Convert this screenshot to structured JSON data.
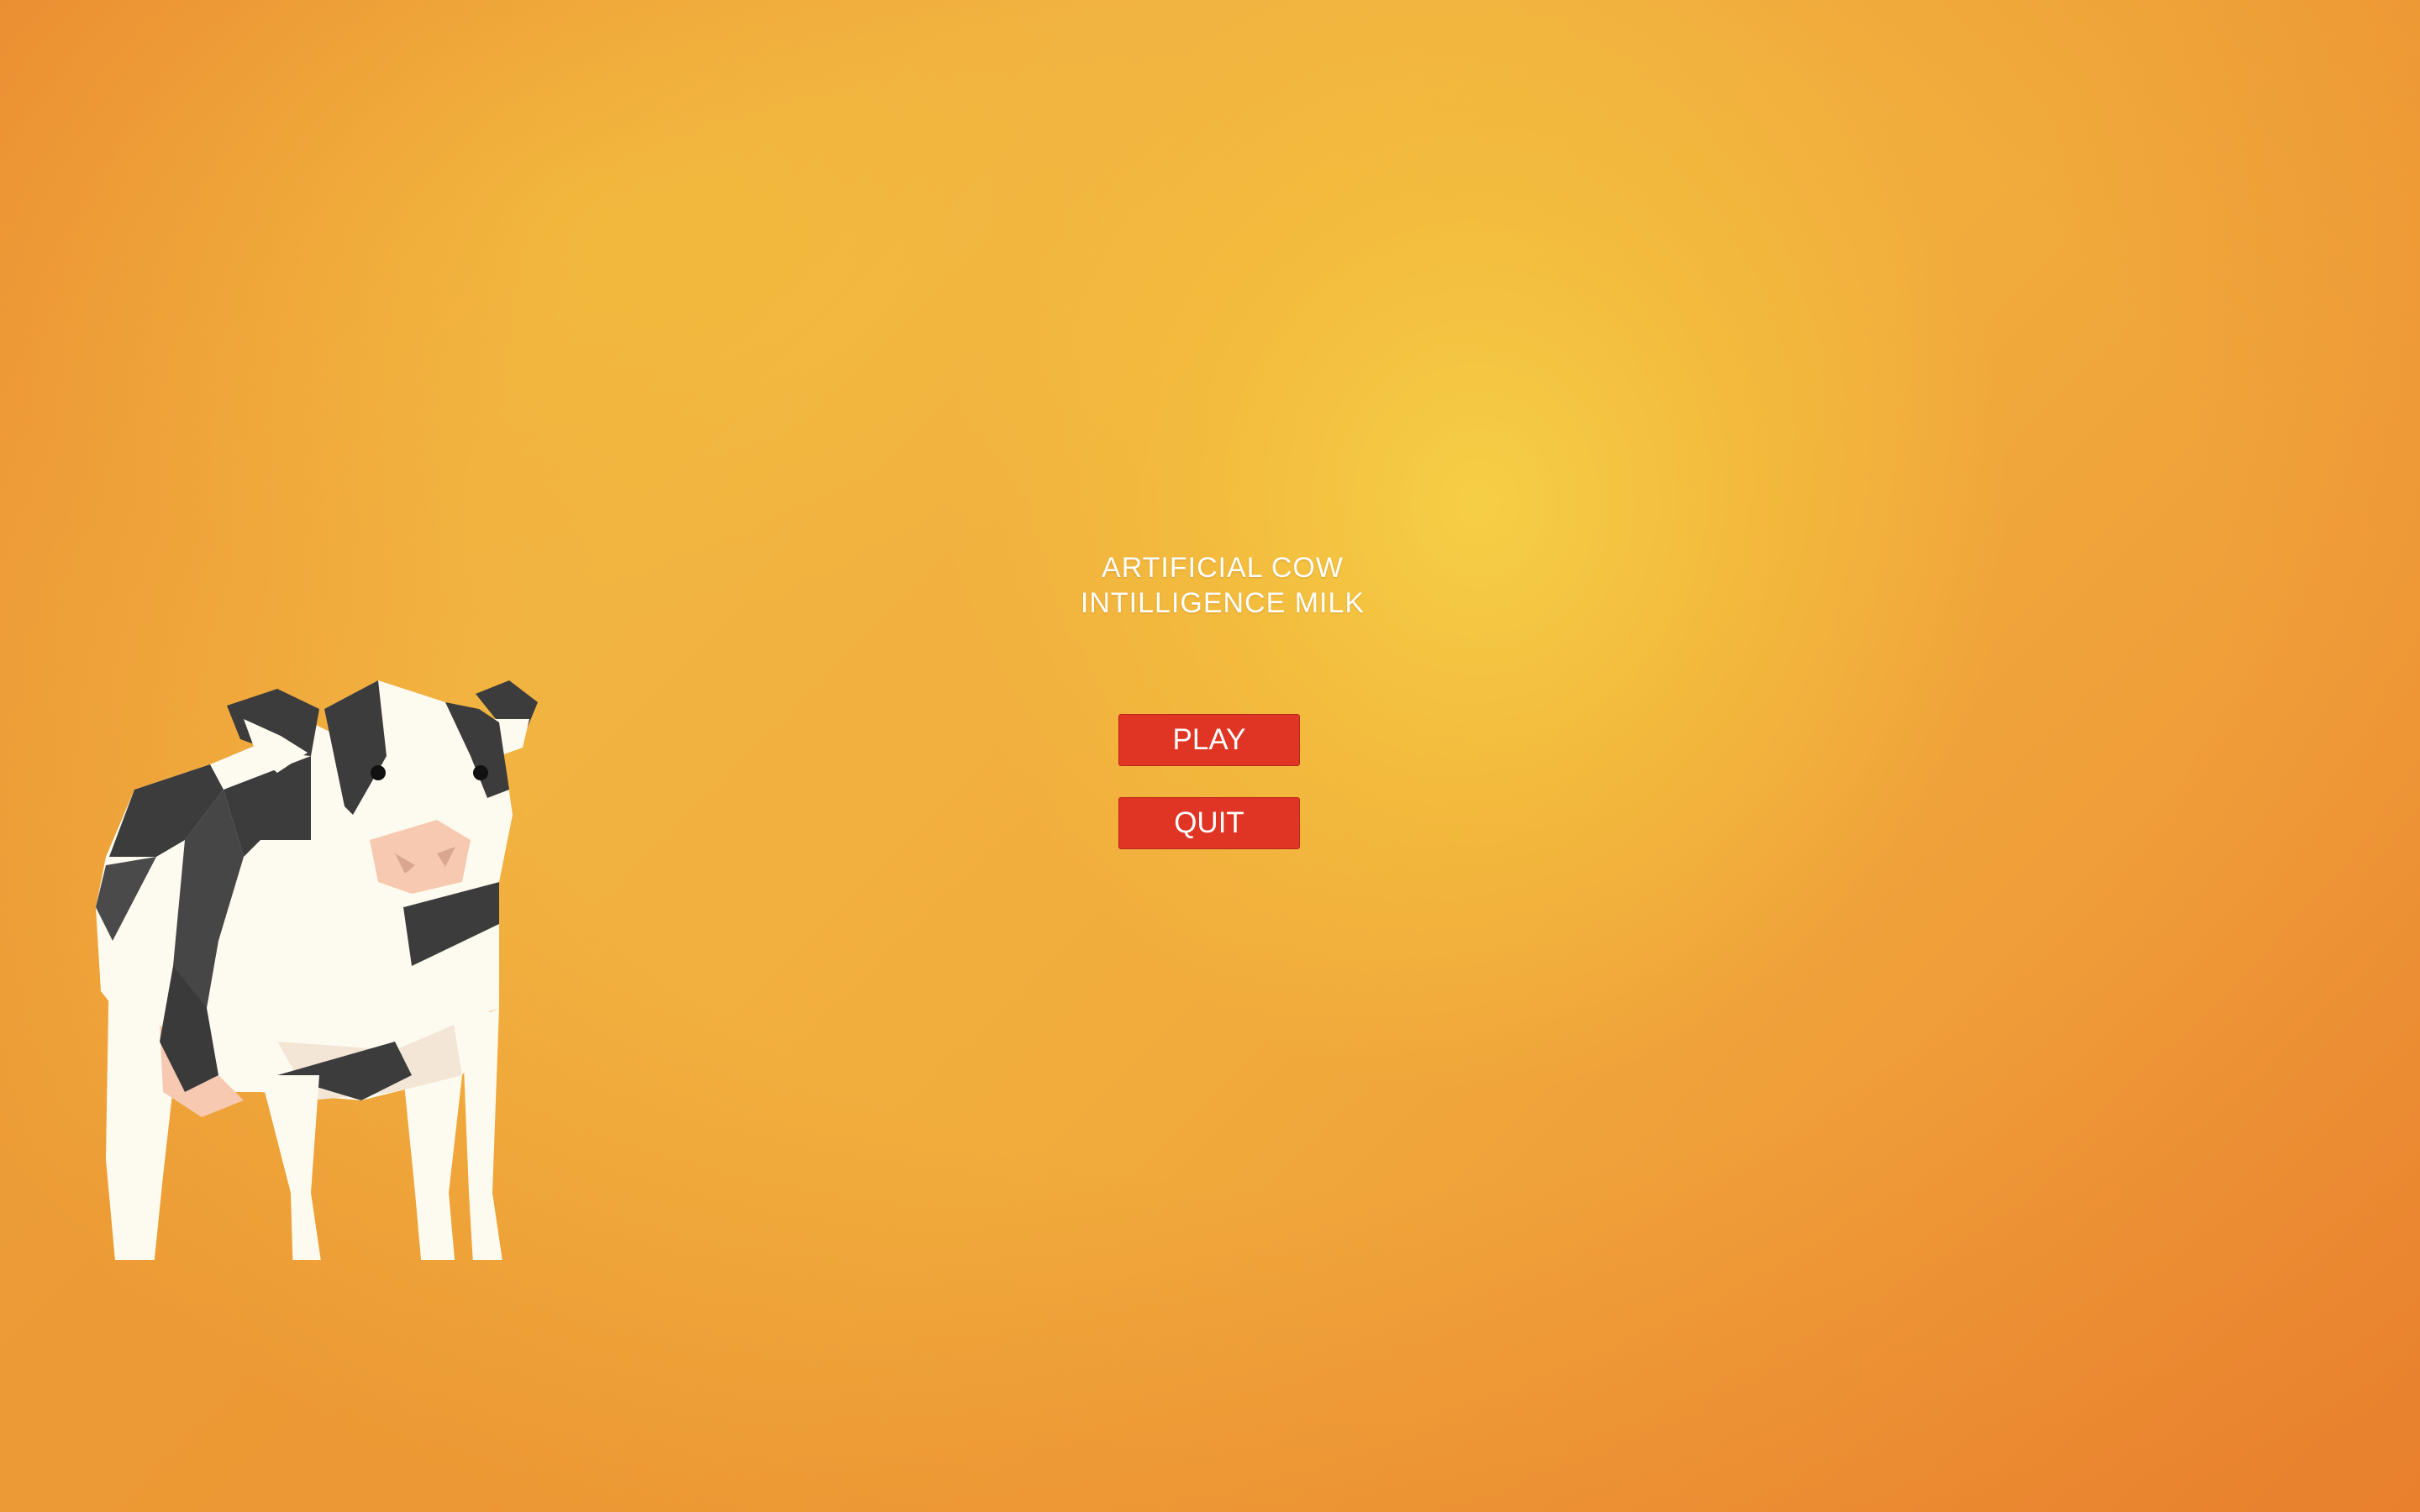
{
  "menu": {
    "title_line1": "ARTIFICIAL COW",
    "title_line2": "INTILLIGENCE MILK",
    "play_label": "PLAY",
    "quit_label": "QUIT"
  },
  "colors": {
    "background_center": "#f6d046",
    "background_edge": "#ec8a33",
    "button": "#e03524",
    "button_text": "#ffffff",
    "title_text": "#ffffff",
    "cow_white": "#fdfbf0",
    "cow_black": "#3c3c3c",
    "cow_pink": "#f6c9b0"
  },
  "icons": {
    "mascot": "low-poly-cow-icon"
  }
}
